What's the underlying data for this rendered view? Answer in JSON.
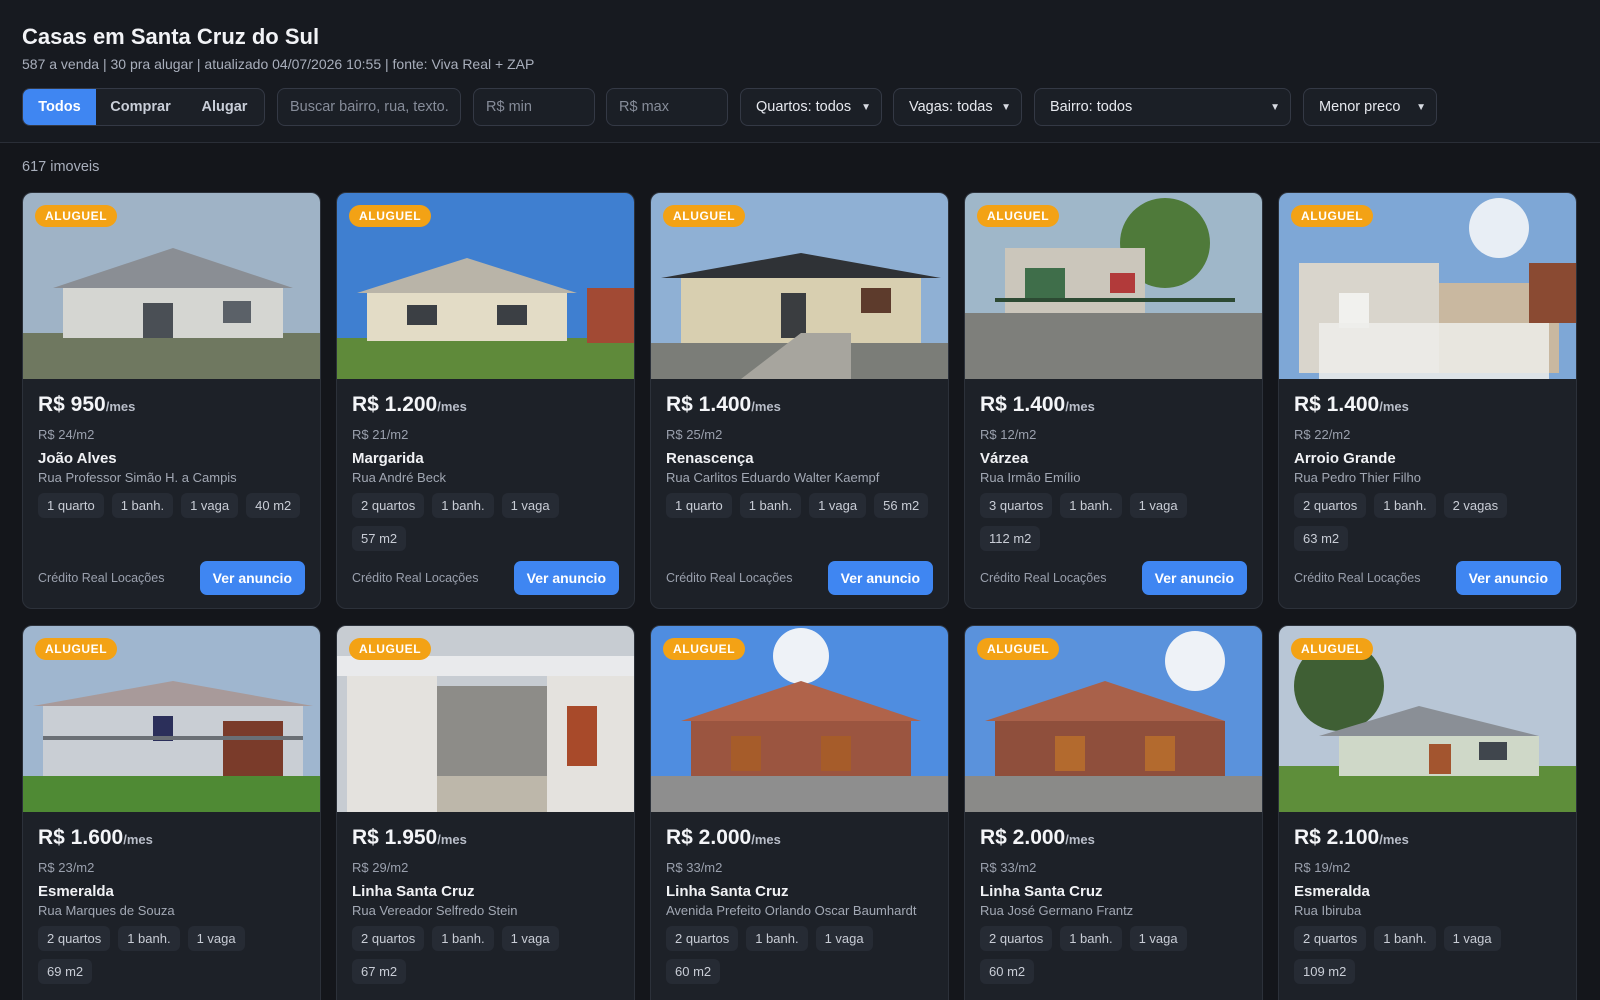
{
  "header": {
    "title": "Casas em Santa Cruz do Sul",
    "subtitle": "587 a venda | 30 pra alugar | atualizado 04/07/2026 10:55 | fonte: Viva Real + ZAP"
  },
  "filters": {
    "modes": [
      "Todos",
      "Comprar",
      "Alugar"
    ],
    "active_mode": "Todos",
    "search_placeholder": "Buscar bairro, rua, texto...",
    "min_placeholder": "R$ min",
    "max_placeholder": "R$ max",
    "rooms": "Quartos: todos",
    "parking": "Vagas: todas",
    "neighborhood": "Bairro: todos",
    "sort": "Menor preco"
  },
  "results_count": "617 imoveis",
  "colors": {
    "accent": "#3f86f2",
    "badge": "#f3a215",
    "background": "#14161b"
  },
  "listings": [
    {
      "badge": "ALUGUEL",
      "price": "R$ 950",
      "period": "/mes",
      "price_per_m2": "R$ 24/m2",
      "neighborhood": "João Alves",
      "street": "Rua Professor Simão H. a Campis",
      "chips": [
        "1 quarto",
        "1 banh.",
        "1 vaga",
        "40 m2"
      ],
      "agency": "Crédito Real Locações",
      "button": "Ver anuncio"
    },
    {
      "badge": "ALUGUEL",
      "price": "R$ 1.200",
      "period": "/mes",
      "price_per_m2": "R$ 21/m2",
      "neighborhood": "Margarida",
      "street": "Rua André Beck",
      "chips": [
        "2 quartos",
        "1 banh.",
        "1 vaga",
        "57 m2"
      ],
      "agency": "Crédito Real Locações",
      "button": "Ver anuncio"
    },
    {
      "badge": "ALUGUEL",
      "price": "R$ 1.400",
      "period": "/mes",
      "price_per_m2": "R$ 25/m2",
      "neighborhood": "Renascença",
      "street": "Rua Carlitos Eduardo Walter Kaempf",
      "chips": [
        "1 quarto",
        "1 banh.",
        "1 vaga",
        "56 m2"
      ],
      "agency": "Crédito Real Locações",
      "button": "Ver anuncio"
    },
    {
      "badge": "ALUGUEL",
      "price": "R$ 1.400",
      "period": "/mes",
      "price_per_m2": "R$ 12/m2",
      "neighborhood": "Várzea",
      "street": "Rua Irmão Emílio",
      "chips": [
        "3 quartos",
        "1 banh.",
        "1 vaga",
        "112 m2"
      ],
      "agency": "Crédito Real Locações",
      "button": "Ver anuncio"
    },
    {
      "badge": "ALUGUEL",
      "price": "R$ 1.400",
      "period": "/mes",
      "price_per_m2": "R$ 22/m2",
      "neighborhood": "Arroio Grande",
      "street": "Rua Pedro Thier Filho",
      "chips": [
        "2 quartos",
        "1 banh.",
        "2 vagas",
        "63 m2"
      ],
      "agency": "Crédito Real Locações",
      "button": "Ver anuncio"
    },
    {
      "badge": "ALUGUEL",
      "price": "R$ 1.600",
      "period": "/mes",
      "price_per_m2": "R$ 23/m2",
      "neighborhood": "Esmeralda",
      "street": "Rua Marques de Souza",
      "chips": [
        "2 quartos",
        "1 banh.",
        "1 vaga",
        "69 m2"
      ],
      "agency": "",
      "button": ""
    },
    {
      "badge": "ALUGUEL",
      "price": "R$ 1.950",
      "period": "/mes",
      "price_per_m2": "R$ 29/m2",
      "neighborhood": "Linha Santa Cruz",
      "street": "Rua Vereador Selfredo Stein",
      "chips": [
        "2 quartos",
        "1 banh.",
        "1 vaga",
        "67 m2"
      ],
      "agency": "",
      "button": ""
    },
    {
      "badge": "ALUGUEL",
      "price": "R$ 2.000",
      "period": "/mes",
      "price_per_m2": "R$ 33/m2",
      "neighborhood": "Linha Santa Cruz",
      "street": "Avenida Prefeito Orlando Oscar Baumhardt",
      "chips": [
        "2 quartos",
        "1 banh.",
        "1 vaga",
        "60 m2"
      ],
      "agency": "",
      "button": ""
    },
    {
      "badge": "ALUGUEL",
      "price": "R$ 2.000",
      "period": "/mes",
      "price_per_m2": "R$ 33/m2",
      "neighborhood": "Linha Santa Cruz",
      "street": "Rua José Germano Frantz",
      "chips": [
        "2 quartos",
        "1 banh.",
        "1 vaga",
        "60 m2"
      ],
      "agency": "",
      "button": ""
    },
    {
      "badge": "ALUGUEL",
      "price": "R$ 2.100",
      "period": "/mes",
      "price_per_m2": "R$ 19/m2",
      "neighborhood": "Esmeralda",
      "street": "Rua Ibiruba",
      "chips": [
        "2 quartos",
        "1 banh.",
        "1 vaga",
        "109 m2"
      ],
      "agency": "",
      "button": ""
    }
  ]
}
